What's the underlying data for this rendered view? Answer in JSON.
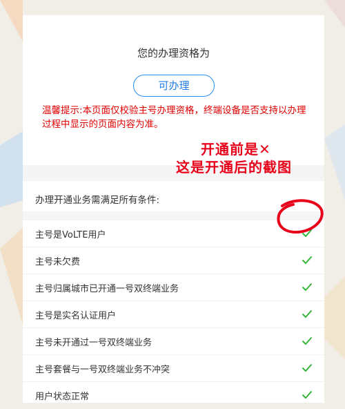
{
  "qualification": {
    "title": "您的办理资格为",
    "status_button": "可办理",
    "tip": "温馨提示:本页面仅校验主号办理资格，终端设备是否支持以办理过程中显示的页面内容为准。"
  },
  "requirements": {
    "header": "办理开通业务需满足所有条件:",
    "items": [
      {
        "label": "主号是VoLTE用户",
        "status": "passed"
      },
      {
        "label": "主号未欠费",
        "status": "passed"
      },
      {
        "label": "主号归属城市已开通一号双终端业务",
        "status": "passed"
      },
      {
        "label": "主号是实名认证用户",
        "status": "passed"
      },
      {
        "label": "主号未开通过一号双终端业务",
        "status": "passed"
      },
      {
        "label": "主号套餐与一号双终端业务不冲突",
        "status": "passed"
      },
      {
        "label": "用户状态正常",
        "status": "passed"
      }
    ]
  },
  "annotation": {
    "line1": "开通前是✕",
    "line2": "这是开通后的截图"
  },
  "colors": {
    "accent_blue": "#2b8ef3",
    "warning_red": "#e00000",
    "check_green": "#35b63a",
    "annotation_red": "#e8001a"
  }
}
